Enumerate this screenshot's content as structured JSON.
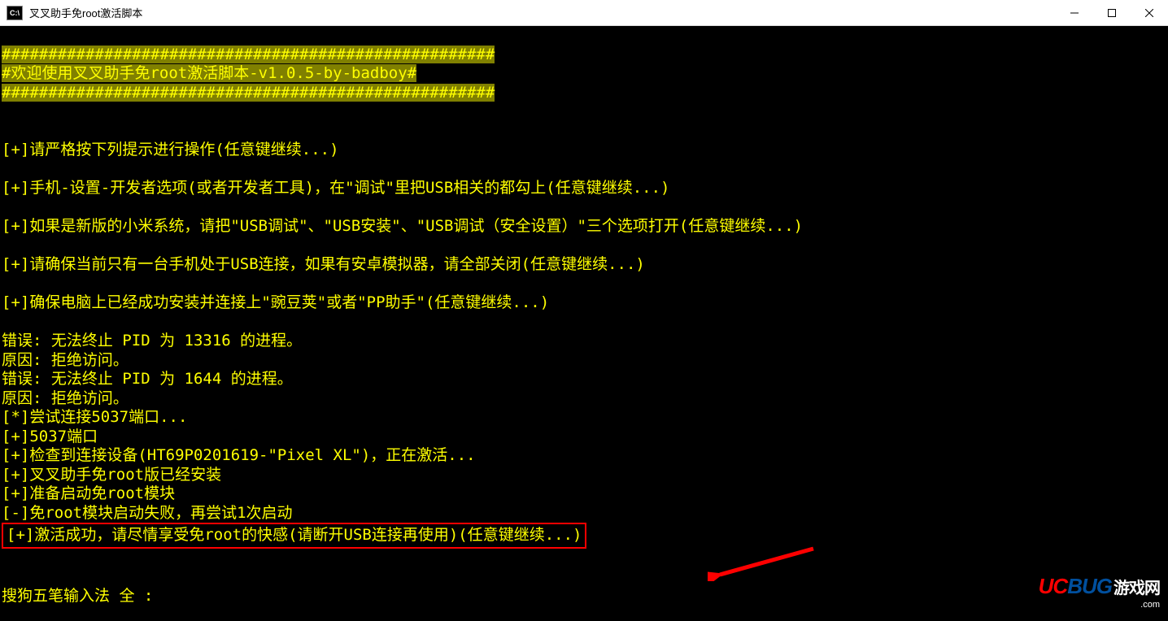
{
  "window": {
    "icon_text": "C:\\",
    "title": "叉叉助手免root激活脚本"
  },
  "banner": {
    "border": "#####################################################",
    "welcome": "#欢迎使用叉叉助手免root激活脚本-v1.0.5-by-badboy#"
  },
  "instructions": [
    "[+]请严格按下列提示进行操作(任意键继续...)",
    "[+]手机-设置-开发者选项(或者开发者工具)，在\"调试\"里把USB相关的都勾上(任意键继续...)",
    "[+]如果是新版的小米系统，请把\"USB调试\"、\"USB安装\"、\"USB调试（安全设置）\"三个选项打开(任意键继续...)",
    "[+]请确保当前只有一台手机处于USB连接，如果有安卓模拟器，请全部关闭(任意键继续...)",
    "[+]确保电脑上已经成功安装并连接上\"豌豆荚\"或者\"PP助手\"(任意键继续...)"
  ],
  "log": [
    "错误: 无法终止 PID 为 13316 的进程。",
    "原因: 拒绝访问。",
    "错误: 无法终止 PID 为 1644 的进程。",
    "原因: 拒绝访问。",
    "[*]尝试连接5037端口...",
    "[+]5037端口",
    "[+]检查到连接设备(HT69P0201619-\"Pixel XL\")，正在激活...",
    "[+]叉叉助手免root版已经安装",
    "[+]准备启动免root模块",
    "[-]免root模块启动失败，再尝试1次启动"
  ],
  "success": "[+]激活成功，请尽情享受免root的快感(请断开USB连接再使用)(任意键继续...)",
  "ime": "搜狗五笔输入法 全 :",
  "watermark": {
    "uc": "UC",
    "bug": "BUG",
    "cn": "游戏网",
    "com": ".com"
  }
}
